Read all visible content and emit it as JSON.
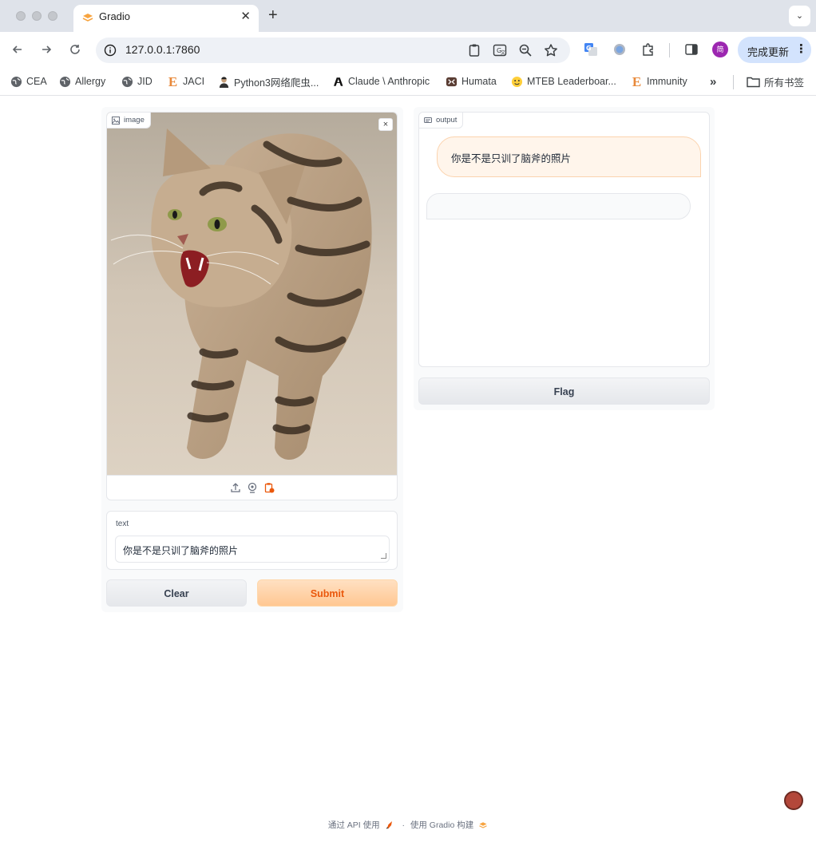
{
  "browser": {
    "tab_title": "Gradio",
    "tab_close": "✕",
    "new_tab": "+",
    "tab_menu": "⌄",
    "url": "127.0.0.1:7860",
    "update_button": "完成更新",
    "update_dots": "⋮",
    "profile_initial": "简",
    "bookmarks": [
      {
        "label": "CEA",
        "icon": "globe-icon"
      },
      {
        "label": "Allergy",
        "icon": "globe-icon"
      },
      {
        "label": "JID",
        "icon": "globe-icon"
      },
      {
        "label": "JACI",
        "icon": "elsevier-e-icon"
      },
      {
        "label": "Python3网络爬虫...",
        "icon": "person-avatar-icon"
      },
      {
        "label": "Claude \\ Anthropic",
        "icon": "anthropic-icon"
      },
      {
        "label": "Humata",
        "icon": "humata-icon"
      },
      {
        "label": "MTEB Leaderboar...",
        "icon": "huggingface-icon"
      },
      {
        "label": "Immunity",
        "icon": "elsevier-e-icon"
      }
    ],
    "bookmarks_overflow": "»",
    "all_bookmarks": "所有书签",
    "e_glyph": "E"
  },
  "app": {
    "image_label": "image",
    "image_close": "×",
    "text_label": "text",
    "text_value": "你是不是只训了脑斧的照片",
    "clear_button": "Clear",
    "submit_button": "Submit",
    "output_label": "output",
    "chat_messages": [
      {
        "role": "user",
        "text": "你是不是只训了脑斧的照片"
      },
      {
        "role": "bot",
        "text": ""
      }
    ],
    "flag_button": "Flag"
  },
  "footer": {
    "api_text": "通过 API 使用",
    "separator": "·",
    "built_with": "使用 Gradio 构建"
  },
  "colors": {
    "accent_orange": "#ea580c",
    "submit_bg": "#ffc792",
    "user_bubble_bg": "#fff5eb",
    "update_btn_bg": "#d3e3fd"
  }
}
